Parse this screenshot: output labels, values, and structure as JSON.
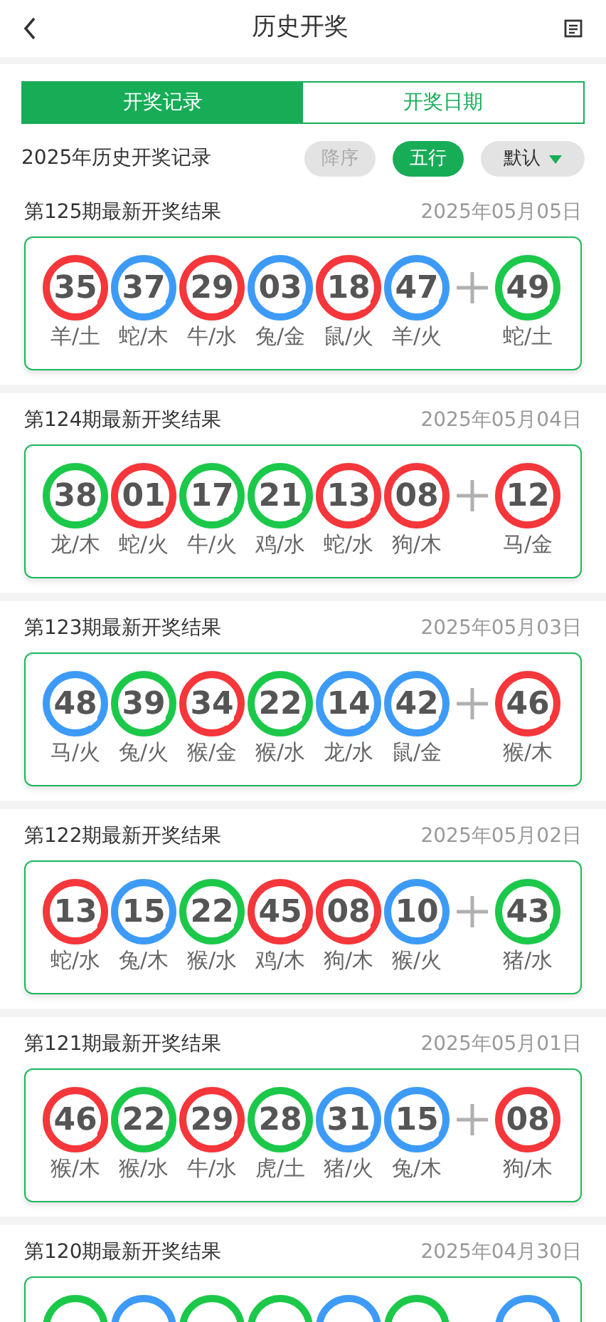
{
  "header": {
    "title": "历史开奖"
  },
  "tabs": [
    {
      "label": "开奖记录",
      "selected": true
    },
    {
      "label": "开奖日期",
      "selected": false
    }
  ],
  "subtitle": "2025年历史开奖记录",
  "filters": [
    {
      "label": "降序",
      "selected": false,
      "kind": "pill"
    },
    {
      "label": "五行",
      "selected": true,
      "kind": "pill"
    },
    {
      "label": "默认",
      "selected": false,
      "kind": "dropdown"
    }
  ],
  "draws": [
    {
      "title": "第125期最新开奖结果",
      "date": "2025年05月05日",
      "plus_shown": true,
      "balls": [
        {
          "number": "35",
          "label": "羊/土",
          "color": "#f5363a"
        },
        {
          "number": "37",
          "label": "蛇/木",
          "color": "#3d9bf7"
        },
        {
          "number": "29",
          "label": "牛/水",
          "color": "#f5363a"
        },
        {
          "number": "03",
          "label": "兔/金",
          "color": "#3d9bf7"
        },
        {
          "number": "18",
          "label": "鼠/火",
          "color": "#f5363a"
        },
        {
          "number": "47",
          "label": "羊/火",
          "color": "#3d9bf7"
        }
      ],
      "special": {
        "number": "49",
        "label": "蛇/土",
        "color": "#1cc84a"
      }
    },
    {
      "title": "第124期最新开奖结果",
      "date": "2025年05月04日",
      "plus_shown": true,
      "balls": [
        {
          "number": "38",
          "label": "龙/木",
          "color": "#1cc84a"
        },
        {
          "number": "01",
          "label": "蛇/火",
          "color": "#f5363a"
        },
        {
          "number": "17",
          "label": "牛/火",
          "color": "#1cc84a"
        },
        {
          "number": "21",
          "label": "鸡/水",
          "color": "#1cc84a"
        },
        {
          "number": "13",
          "label": "蛇/水",
          "color": "#f5363a"
        },
        {
          "number": "08",
          "label": "狗/木",
          "color": "#f5363a"
        }
      ],
      "special": {
        "number": "12",
        "label": "马/金",
        "color": "#f5363a"
      }
    },
    {
      "title": "第123期最新开奖结果",
      "date": "2025年05月03日",
      "plus_shown": true,
      "balls": [
        {
          "number": "48",
          "label": "马/火",
          "color": "#3d9bf7"
        },
        {
          "number": "39",
          "label": "兔/火",
          "color": "#1cc84a"
        },
        {
          "number": "34",
          "label": "猴/金",
          "color": "#f5363a"
        },
        {
          "number": "22",
          "label": "猴/水",
          "color": "#1cc84a"
        },
        {
          "number": "14",
          "label": "龙/水",
          "color": "#3d9bf7"
        },
        {
          "number": "42",
          "label": "鼠/金",
          "color": "#3d9bf7"
        }
      ],
      "special": {
        "number": "46",
        "label": "猴/木",
        "color": "#f5363a"
      }
    },
    {
      "title": "第122期最新开奖结果",
      "date": "2025年05月02日",
      "plus_shown": true,
      "balls": [
        {
          "number": "13",
          "label": "蛇/水",
          "color": "#f5363a"
        },
        {
          "number": "15",
          "label": "兔/木",
          "color": "#3d9bf7"
        },
        {
          "number": "22",
          "label": "猴/水",
          "color": "#1cc84a"
        },
        {
          "number": "45",
          "label": "鸡/木",
          "color": "#f5363a"
        },
        {
          "number": "08",
          "label": "狗/木",
          "color": "#f5363a"
        },
        {
          "number": "10",
          "label": "猴/火",
          "color": "#3d9bf7"
        }
      ],
      "special": {
        "number": "43",
        "label": "猪/水",
        "color": "#1cc84a"
      }
    },
    {
      "title": "第121期最新开奖结果",
      "date": "2025年05月01日",
      "plus_shown": true,
      "balls": [
        {
          "number": "46",
          "label": "猴/木",
          "color": "#f5363a"
        },
        {
          "number": "22",
          "label": "猴/水",
          "color": "#1cc84a"
        },
        {
          "number": "29",
          "label": "牛/水",
          "color": "#f5363a"
        },
        {
          "number": "28",
          "label": "虎/土",
          "color": "#1cc84a"
        },
        {
          "number": "31",
          "label": "猪/火",
          "color": "#3d9bf7"
        },
        {
          "number": "15",
          "label": "兔/木",
          "color": "#3d9bf7"
        }
      ],
      "special": {
        "number": "08",
        "label": "狗/木",
        "color": "#f5363a"
      }
    },
    {
      "title": "第120期最新开奖结果",
      "date": "2025年04月30日",
      "plus_shown": false,
      "balls": [
        {
          "color": "#1cc84a"
        },
        {
          "color": "#3d9bf7"
        },
        {
          "color": "#1cc84a"
        },
        {
          "color": "#1cc84a"
        },
        {
          "color": "#3d9bf7"
        },
        {
          "color": "#1cc84a"
        }
      ],
      "special": {
        "color": "#3d9bf7"
      }
    }
  ]
}
